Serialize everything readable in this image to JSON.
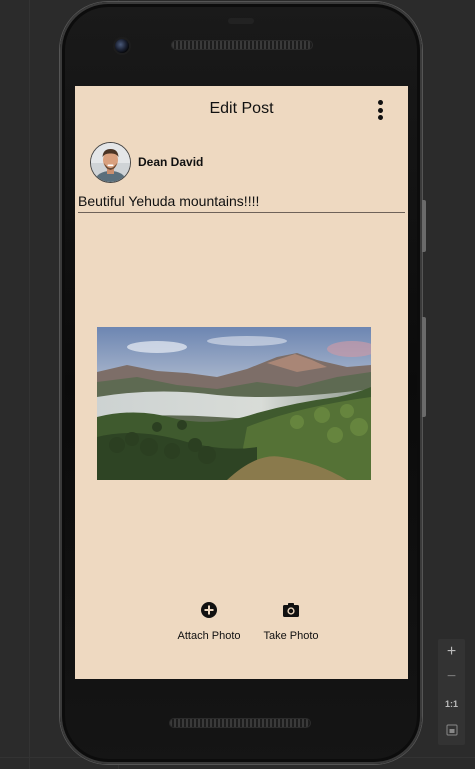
{
  "toolbar": {
    "title": "Edit Post",
    "menu_icon": "more-vert-icon"
  },
  "user": {
    "name": "Dean David",
    "avatar_icon": "avatar"
  },
  "post": {
    "caption": "Beutiful Yehuda mountains!!!!",
    "image": "mountain landscape photo"
  },
  "actions": [
    {
      "label": "Attach Photo",
      "icon": "add-circle-icon"
    },
    {
      "label": "Take Photo",
      "icon": "camera-icon"
    }
  ],
  "emulator": {
    "zoom_in": "+",
    "zoom_out": "−",
    "actual_size": "1:1",
    "fit_icon": "fit-screen-icon"
  },
  "colors": {
    "screen_background": "#eed9c1",
    "text": "#111111"
  }
}
